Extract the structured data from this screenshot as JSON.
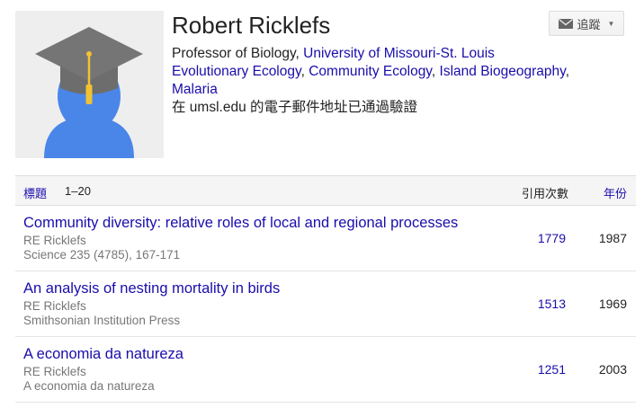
{
  "profile": {
    "name": "Robert Ricklefs",
    "follow_label": "追蹤",
    "affiliation_prefix": "Professor of Biology, ",
    "affiliation_link": "University of Missouri-St. Louis",
    "interests": [
      "Evolutionary Ecology",
      "Community Ecology",
      "Island Biogeography"
    ],
    "interest_sep": ", ",
    "interest_trailing": ",",
    "interest_last": "Malaria",
    "email_note": "在 umsl.edu 的電子郵件地址已通過驗證"
  },
  "table": {
    "title_header": "標題",
    "range": "1–20",
    "cites_header": "引用次數",
    "year_header": "年份"
  },
  "papers": [
    {
      "title": "Community diversity: relative roles of local and regional processes",
      "authors": "RE Ricklefs",
      "venue": "Science 235 (4785), 167-171",
      "cites": "1779",
      "year": "1987"
    },
    {
      "title": "An analysis of nesting mortality in birds",
      "authors": "RE Ricklefs",
      "venue": "Smithsonian Institution Press",
      "cites": "1513",
      "year": "1969"
    },
    {
      "title": "A economia da natureza",
      "authors": "RE Ricklefs",
      "venue": "A economia da natureza",
      "cites": "1251",
      "year": "2003"
    }
  ],
  "colors": {
    "link": "#1a0dab",
    "avatar_bg": "#eeeeee",
    "avatar_body": "#4a86e8",
    "cap": "#707070",
    "tassel": "#f1c232"
  },
  "icons": {
    "follow": "mail-icon",
    "dropdown": "caret-down-icon",
    "avatar": "graduate-avatar-icon"
  }
}
